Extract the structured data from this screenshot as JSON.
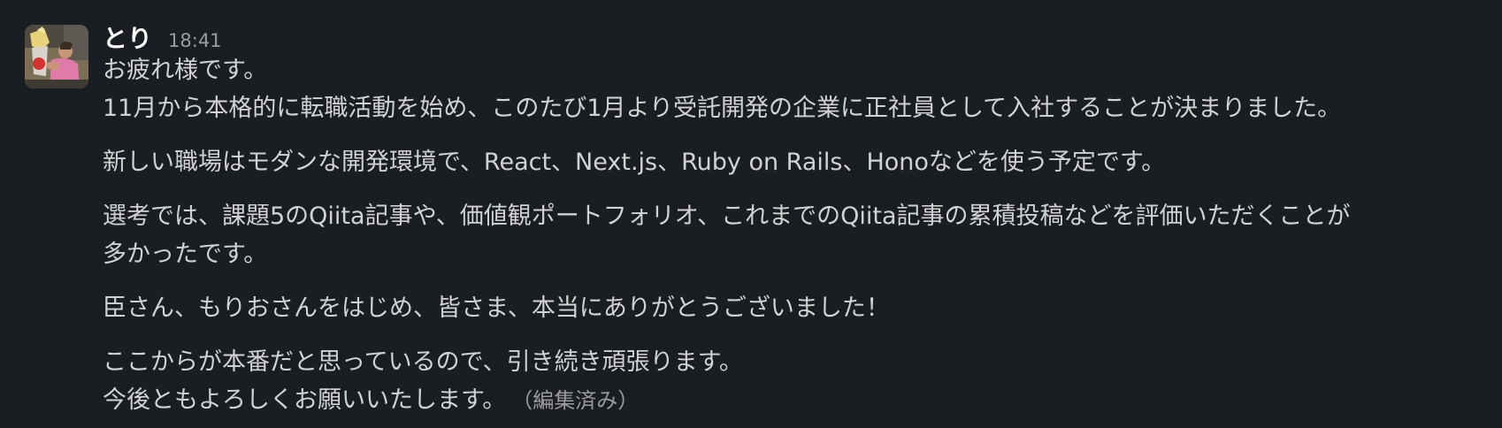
{
  "message": {
    "sender": "とり",
    "time": "18:41",
    "edited_label": "（編集済み）",
    "paragraphs": [
      {
        "lines": [
          "お疲れ様です。",
          "11月から本格的に転職活動を始め、このたび1月より受託開発の企業に正社員として入社することが決まりました。"
        ]
      },
      {
        "lines": [
          "新しい職場はモダンな開発環境で、React、Next.js、Ruby on Rails、Honoなどを使う予定です。"
        ]
      },
      {
        "lines": [
          "選考では、課題5のQiita記事や、価値観ポートフォリオ、これまでのQiita記事の累積投稿などを評価いただくことが",
          "多かったです。"
        ]
      },
      {
        "lines": [
          "臣さん、もりおさんをはじめ、皆さま、本当にありがとうございました！"
        ]
      },
      {
        "lines": [
          "ここからが本番だと思っているので、引き続き頑張ります。",
          "今後ともよろしくお願いいたします。"
        ]
      }
    ]
  },
  "colors": {
    "background": "#1a1d21",
    "text": "#d1d2d3",
    "sender": "#ffffff",
    "muted": "#9a9b9d"
  }
}
